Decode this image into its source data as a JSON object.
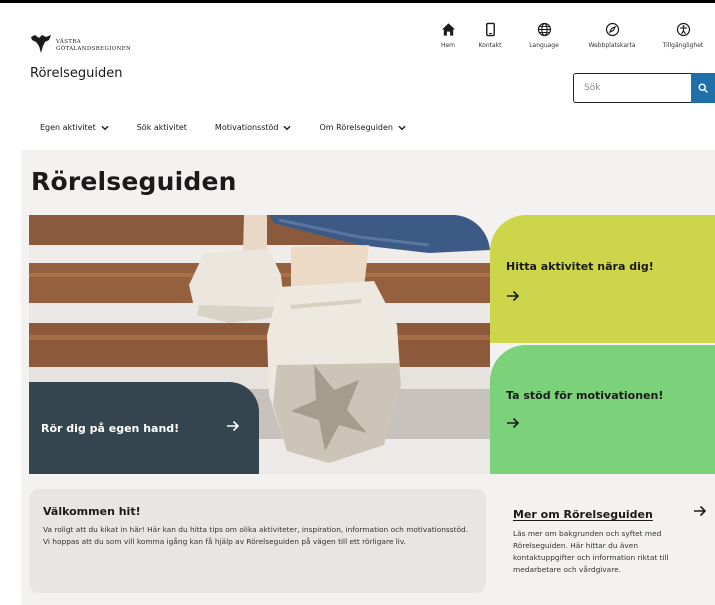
{
  "header": {
    "logo_line1": "VÄSTRA",
    "logo_line2": "GÖTALANDSREGIONEN",
    "site_name": "Rörelseguiden"
  },
  "utility_nav": [
    {
      "label": "Hem",
      "icon": "home-icon"
    },
    {
      "label": "Kontakt",
      "icon": "phone-icon"
    },
    {
      "label": "Language",
      "icon": "globe-icon"
    },
    {
      "label": "Webbplatskarta",
      "icon": "compass-icon"
    },
    {
      "label": "Tillgänglighet",
      "icon": "accessibility-icon"
    }
  ],
  "search": {
    "placeholder": "Sök",
    "button_icon": "search-icon"
  },
  "main_nav": [
    {
      "label": "Egen aktivitet",
      "has_dropdown": true
    },
    {
      "label": "Sök aktivitet",
      "has_dropdown": false
    },
    {
      "label": "Motivationsstöd",
      "has_dropdown": true
    },
    {
      "label": "Om Rörelseguiden",
      "has_dropdown": true
    }
  ],
  "page": {
    "title": "Rörelseguiden"
  },
  "tiles": {
    "own": {
      "label": "Rör dig på egen hand!",
      "color": "#34454f"
    },
    "find": {
      "label": "Hitta aktivitet nära dig!",
      "color": "#cdd64a"
    },
    "support": {
      "label": "Ta stöd för motivationen!",
      "color": "#7cd27b"
    }
  },
  "welcome": {
    "heading": "Välkommen hit!",
    "body": "Va roligt att du kikat in här! Här kan du hitta tips om olika aktiviteter, inspiration, information och motivationsstöd. Vi hoppas att du som vill komma igång kan få hjälp av Rörelseguiden på vägen till ett rörligare liv."
  },
  "more": {
    "link": "Mer om Rörelseguiden",
    "body": "Läs mer om bakgrunden och syftet med Rörelseguiden. Här hittar du även kontaktuppgifter och information riktat till medarbetare och vårdgivare."
  },
  "colors": {
    "accent_blue": "#1f6fa8",
    "background": "#f4f2f1"
  }
}
